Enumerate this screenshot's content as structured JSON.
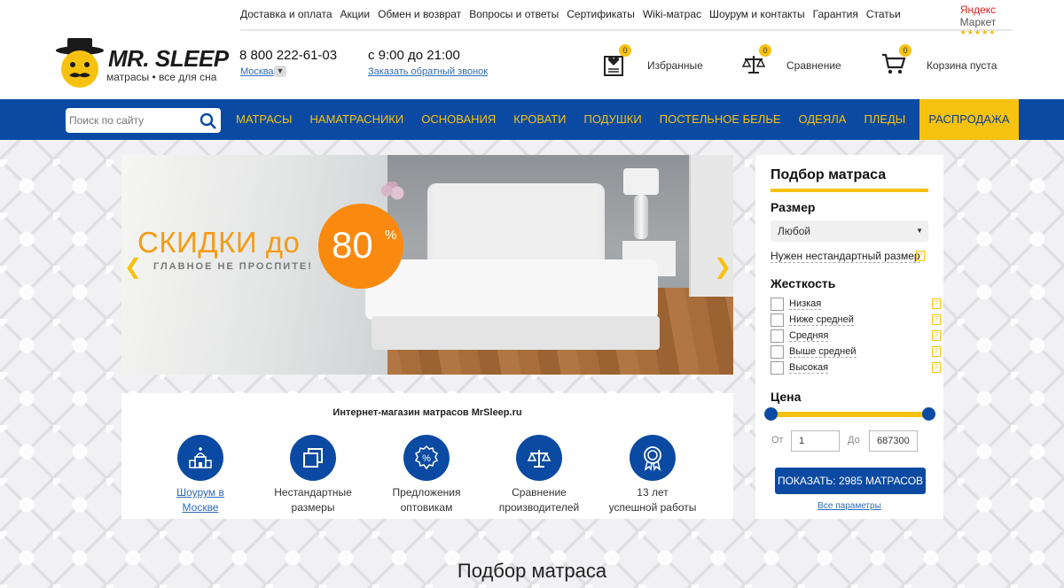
{
  "top_links": [
    "Доставка и оплата",
    "Акции",
    "Обмен и возврат",
    "Вопросы и ответы",
    "Сертификаты",
    "Wiki-матрас",
    "Шоурум и контакты",
    "Гарантия",
    "Статьи"
  ],
  "yandex": {
    "brand": "Яндекс",
    "name": "Маркет",
    "stars": "★★★★★"
  },
  "logo": {
    "name": "MR. SLEEP",
    "tagline": "матрасы • все для сна"
  },
  "contact": {
    "phone": "8 800 222-61-03",
    "city": "Москва",
    "hours": "с 9:00 до 21:00",
    "callback": "Заказать обратный звонок"
  },
  "header_items": {
    "favorites": {
      "label": "Избранные",
      "count": "0",
      "icon": "heart-clipboard-icon"
    },
    "compare": {
      "label": "Сравнение",
      "count": "0",
      "icon": "scales-icon"
    },
    "cart": {
      "label": "Корзина пуста",
      "count": "0",
      "icon": "cart-icon"
    }
  },
  "search": {
    "placeholder": "Поиск по сайту"
  },
  "nav": [
    "Матрасы",
    "Наматрасники",
    "Основания",
    "Кровати",
    "Подушки",
    "Постельное белье",
    "Одеяла",
    "Пледы"
  ],
  "nav_sale": "Распродажа",
  "banner": {
    "headline": "СКИДКИ до",
    "subline": "ГЛАВНОЕ НЕ ПРОСПИТЕ!",
    "discount": "80",
    "percent": "%",
    "prev": "❮",
    "next": "❯"
  },
  "features": {
    "title": "Интернет-магазин матрасов MrSleep.ru",
    "items": [
      {
        "line1": "Шоурум в",
        "line2": "Москве",
        "icon": "church-icon"
      },
      {
        "line1": "Нестандартные",
        "line2": "размеры",
        "icon": "squares-icon"
      },
      {
        "line1": "Предложения",
        "line2": "оптовикам",
        "icon": "percent-badge-icon"
      },
      {
        "line1": "Сравнение",
        "line2": "производителей",
        "icon": "scales-icon"
      },
      {
        "line1": "13 лет",
        "line2": "успешной работы",
        "icon": "award-icon"
      }
    ]
  },
  "filter": {
    "title": "Подбор матраса",
    "size_label": "Размер",
    "size_value": "Любой",
    "custom_size": "Нужен нестандартный размер",
    "hardness_label": "Жесткость",
    "hardness": [
      "Низкая",
      "Ниже средней",
      "Средняя",
      "Выше средней",
      "Высокая"
    ],
    "price_label": "Цена",
    "from_label": "От",
    "to_label": "До",
    "price_from": "1",
    "price_to": "687300",
    "show_button": "ПОКАЗАТЬ: 2985 МАТРАСОВ",
    "all_params": "Все параметры"
  },
  "bottom_title": "Подбор матраса",
  "colors": {
    "primary_blue": "#0b4aa2",
    "accent_yellow": "#f7c20f",
    "promo_orange": "#f98a0f",
    "link_blue": "#2d6bb6"
  }
}
